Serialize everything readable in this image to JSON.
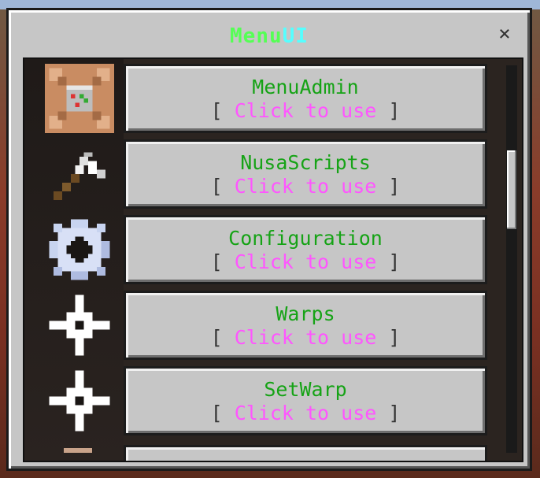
{
  "window": {
    "title_part1": "Menu",
    "title_part2": "UI",
    "close_label": "×"
  },
  "colors": {
    "title_part1": "#55ff55",
    "title_part2": "#55ffff",
    "item_name": "#16a316",
    "click_text": "#ff55ff",
    "bracket": "#333333",
    "panel_bg": "#c6c6c6"
  },
  "items": [
    {
      "name": "MenuAdmin",
      "bracket_open": "[",
      "action": "Click to use",
      "bracket_close": "]",
      "icon": "command-block-icon"
    },
    {
      "name": "NusaScripts",
      "bracket_open": "[",
      "action": "Click to use",
      "bracket_close": "]",
      "icon": "hammer-icon"
    },
    {
      "name": "Configuration",
      "bracket_open": "[",
      "action": "Click to use",
      "bracket_close": "]",
      "icon": "gear-icon"
    },
    {
      "name": "Warps",
      "bracket_open": "[",
      "action": "Click to use",
      "bracket_close": "]",
      "icon": "crosshair-icon"
    },
    {
      "name": "SetWarp",
      "bracket_open": "[",
      "action": "Click to use",
      "bracket_close": "]",
      "icon": "crosshair-icon"
    }
  ]
}
